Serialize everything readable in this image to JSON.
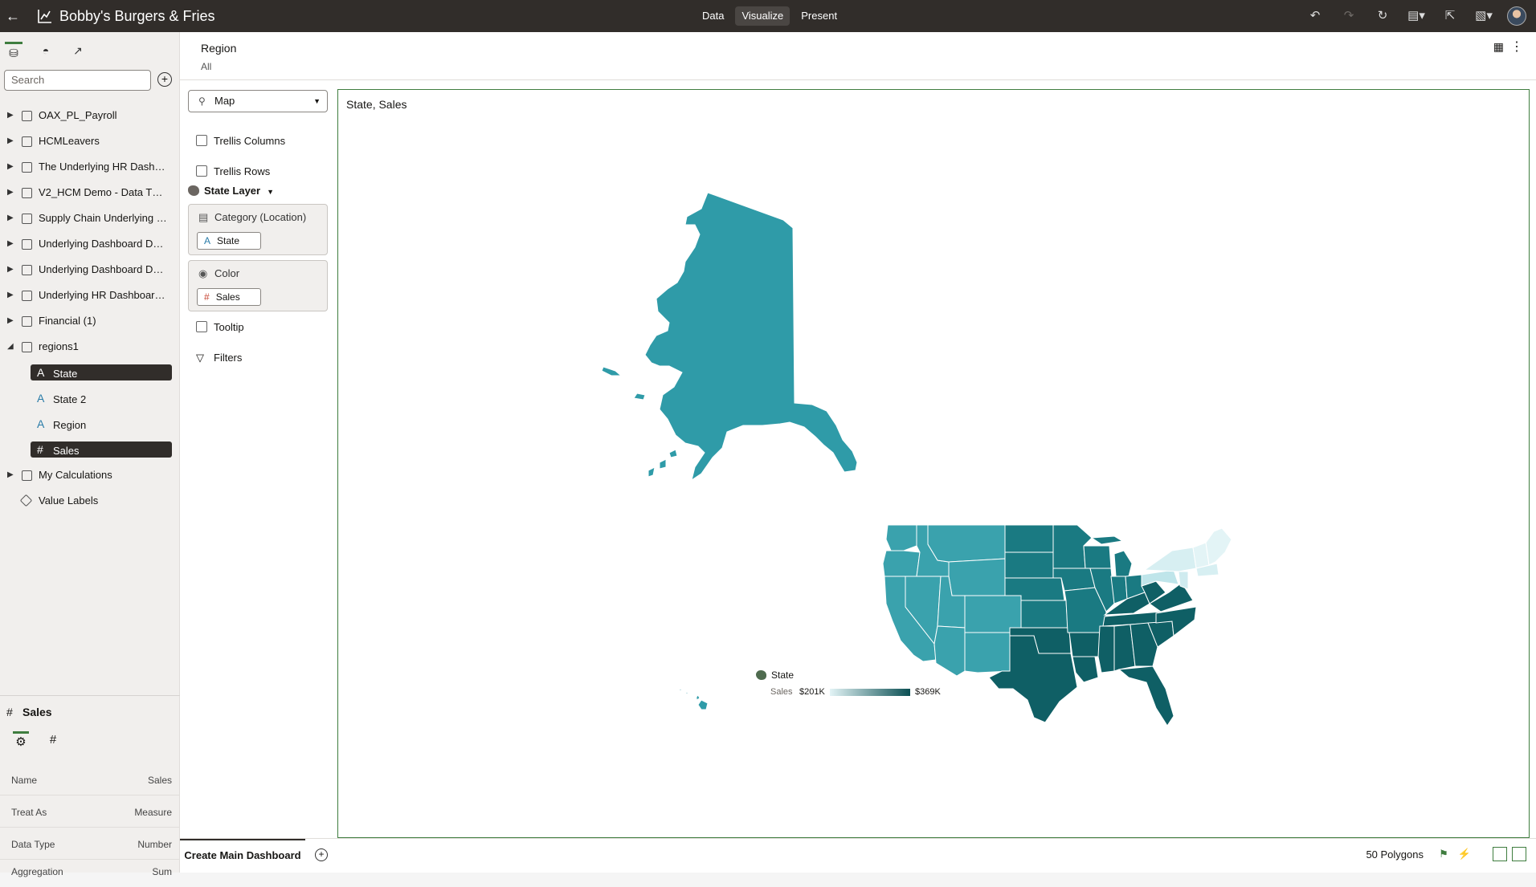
{
  "header": {
    "title": "Bobby's Burgers & Fries",
    "modes": [
      "Data",
      "Visualize",
      "Present"
    ],
    "active_mode": "Visualize"
  },
  "data_panel": {
    "search_placeholder": "Search",
    "datasets": [
      "OAX_PL_Payroll",
      "HCMLeavers",
      "The Underlying HR Dashb…",
      "V2_HCM Demo - Data TT …",
      "Supply Chain Underlying …",
      "Underlying Dashboard Da…",
      "Underlying Dashboard Da…",
      "Underlying HR Dashboard…",
      "Financial (1)",
      "regions1"
    ],
    "columns": [
      {
        "type": "A",
        "label": "State",
        "selected": true
      },
      {
        "type": "A",
        "label": "State 2",
        "selected": false
      },
      {
        "type": "A",
        "label": "Region",
        "selected": false
      },
      {
        "type": "#",
        "label": "Sales",
        "selected": true
      }
    ],
    "folders": [
      "My Calculations",
      "Value Labels"
    ]
  },
  "properties": {
    "title": "Sales",
    "rows": [
      {
        "key": "Name",
        "value": "Sales"
      },
      {
        "key": "Treat As",
        "value": "Measure"
      },
      {
        "key": "Data Type",
        "value": "Number"
      },
      {
        "key": "Aggregation",
        "value": "Sum"
      }
    ]
  },
  "filter_bar": {
    "name": "Region",
    "value": "All"
  },
  "grammar": {
    "viz_type": "Map",
    "trellis_columns": "Trellis Columns",
    "trellis_rows": "Trellis Rows",
    "layer": "State Layer",
    "category_label": "Category (Location)",
    "category_chip": "State",
    "color_label": "Color",
    "color_chip": "Sales",
    "tooltip": "Tooltip",
    "filters": "Filters"
  },
  "visualization": {
    "title": "State, Sales",
    "legend": {
      "layer": "State",
      "measure": "Sales",
      "min": "$201K",
      "max": "$369K",
      "color_low": "#e3f4f6",
      "color_high": "#0b4f53"
    }
  },
  "footer": {
    "canvas_tab": "Create Main Dashboard",
    "status": "50 Polygons"
  },
  "colors": {
    "topbar": "#312d2a",
    "accent": "#3f7d3f",
    "map_mid": "#2f9ba8"
  }
}
